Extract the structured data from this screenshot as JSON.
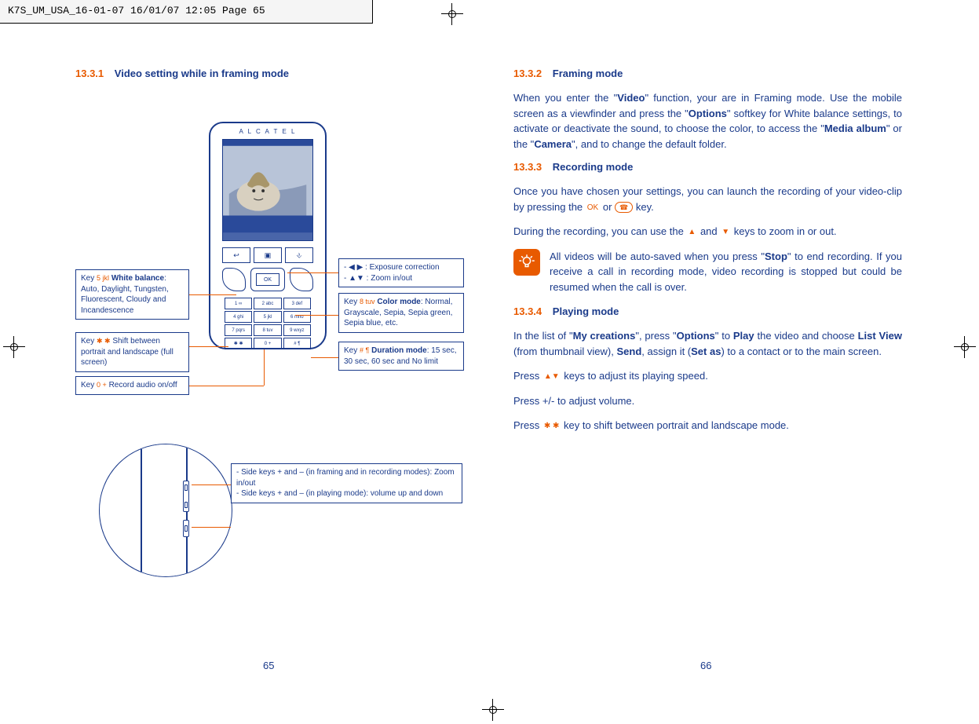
{
  "header_stamp": "K7S_UM_USA_16-01-07  16/01/07  12:05  Page 65",
  "page_left_num": "65",
  "page_right_num": "66",
  "left": {
    "s1": {
      "num": "13.3.1",
      "title": "Video setting while in framing mode"
    },
    "callouts": {
      "c_nav": {
        "line1": "- ◀ ▶ : Exposure correction",
        "line2": "- ▲▼ : Zoom in/out"
      },
      "c_wb": {
        "pre": "Key ",
        "glyph": "5 jkl",
        "bold": "White balance",
        "rest": ": Auto, Daylight, Tungsten, Fluorescent, Cloudy and Incandescence"
      },
      "c_shift": {
        "pre": "Key ",
        "glyph": "✱ ✱",
        "rest": " Shift between portrait and landscape (full screen)"
      },
      "c_rec": {
        "pre": "Key ",
        "glyph": "0 +",
        "rest": " Record audio on/off"
      },
      "c_color": {
        "pre": "Key ",
        "glyph": "8 tuv",
        "bold": "Color mode",
        "rest": ": Normal, Grayscale, Sepia, Sepia green, Sepia blue, etc."
      },
      "c_dur": {
        "pre": "Key ",
        "glyph": "# ¶",
        "bold": "Duration mode",
        "rest": ": 15 sec, 30 sec, 60 sec and No limit"
      },
      "c_side": {
        "line1": "- Side keys + and – (in framing and in recording modes): Zoom in/out",
        "line2": "- Side keys + and – (in playing mode): volume up and down"
      }
    },
    "keypad": [
      "1 ∞",
      "2 abc",
      "3 def",
      "4 ghi",
      "5 jkl",
      "6 mno",
      "7 pqrs",
      "8 tuv",
      "9 wxyz",
      "✱ ✱",
      "0 +",
      "# ¶"
    ],
    "brand": "A L C A T E L"
  },
  "right": {
    "s2": {
      "num": "13.3.2",
      "title": "Framing mode"
    },
    "p2": {
      "t1": "When you enter the \"",
      "b1": "Video",
      "t2": "\" function, your are in Framing mode. Use the mobile screen as a viewfinder and press the \"",
      "b2": "Options",
      "t3": "\" softkey for White balance settings, to activate or deactivate the sound, to choose the color, to access the \"",
      "b3": "Media album",
      "t4": "\" or the \"",
      "b4": "Camera",
      "t5": "\", and to change the default folder."
    },
    "s3": {
      "num": "13.3.3",
      "title": "Recording mode"
    },
    "p3a": {
      "t1": "Once you have chosen your settings, you can launch the recording of your video-clip by pressing the ",
      "k1": "OK",
      "t2": " or ",
      "k2": "☎",
      "t3": " key."
    },
    "p3b": {
      "t1": "During the recording, you can use the ",
      "up": "▲",
      "t2": " and ",
      "down": "▼",
      "t3": " keys to zoom in or out."
    },
    "note": {
      "t1": "All videos will be auto-saved when you press \"",
      "b1": "Stop",
      "t2": "\" to end recording. If you receive a call in recording mode, video recording is stopped but could be resumed when the call is over."
    },
    "s4": {
      "num": "13.3.4",
      "title": "Playing mode"
    },
    "p4a": {
      "t1": "In the list of \"",
      "b1": "My creations",
      "t2": "\", press \"",
      "b2": "Options",
      "t3": "\" to ",
      "b3": "Play",
      "t4": " the video and choose ",
      "b4": "List View",
      "t5": " (from thumbnail view), ",
      "b5": "Send",
      "t6": ", assign it (",
      "b6": "Set as",
      "t7": ") to a contact or to the main screen."
    },
    "p4b": {
      "t1": "Press ",
      "g1": "▲▼",
      "t2": " keys to adjust its playing speed."
    },
    "p4c": "Press +/- to adjust volume.",
    "p4d": {
      "t1": "Press ",
      "g1": "✱ ✱",
      "t2": " key to shift between portrait and landscape mode."
    }
  }
}
